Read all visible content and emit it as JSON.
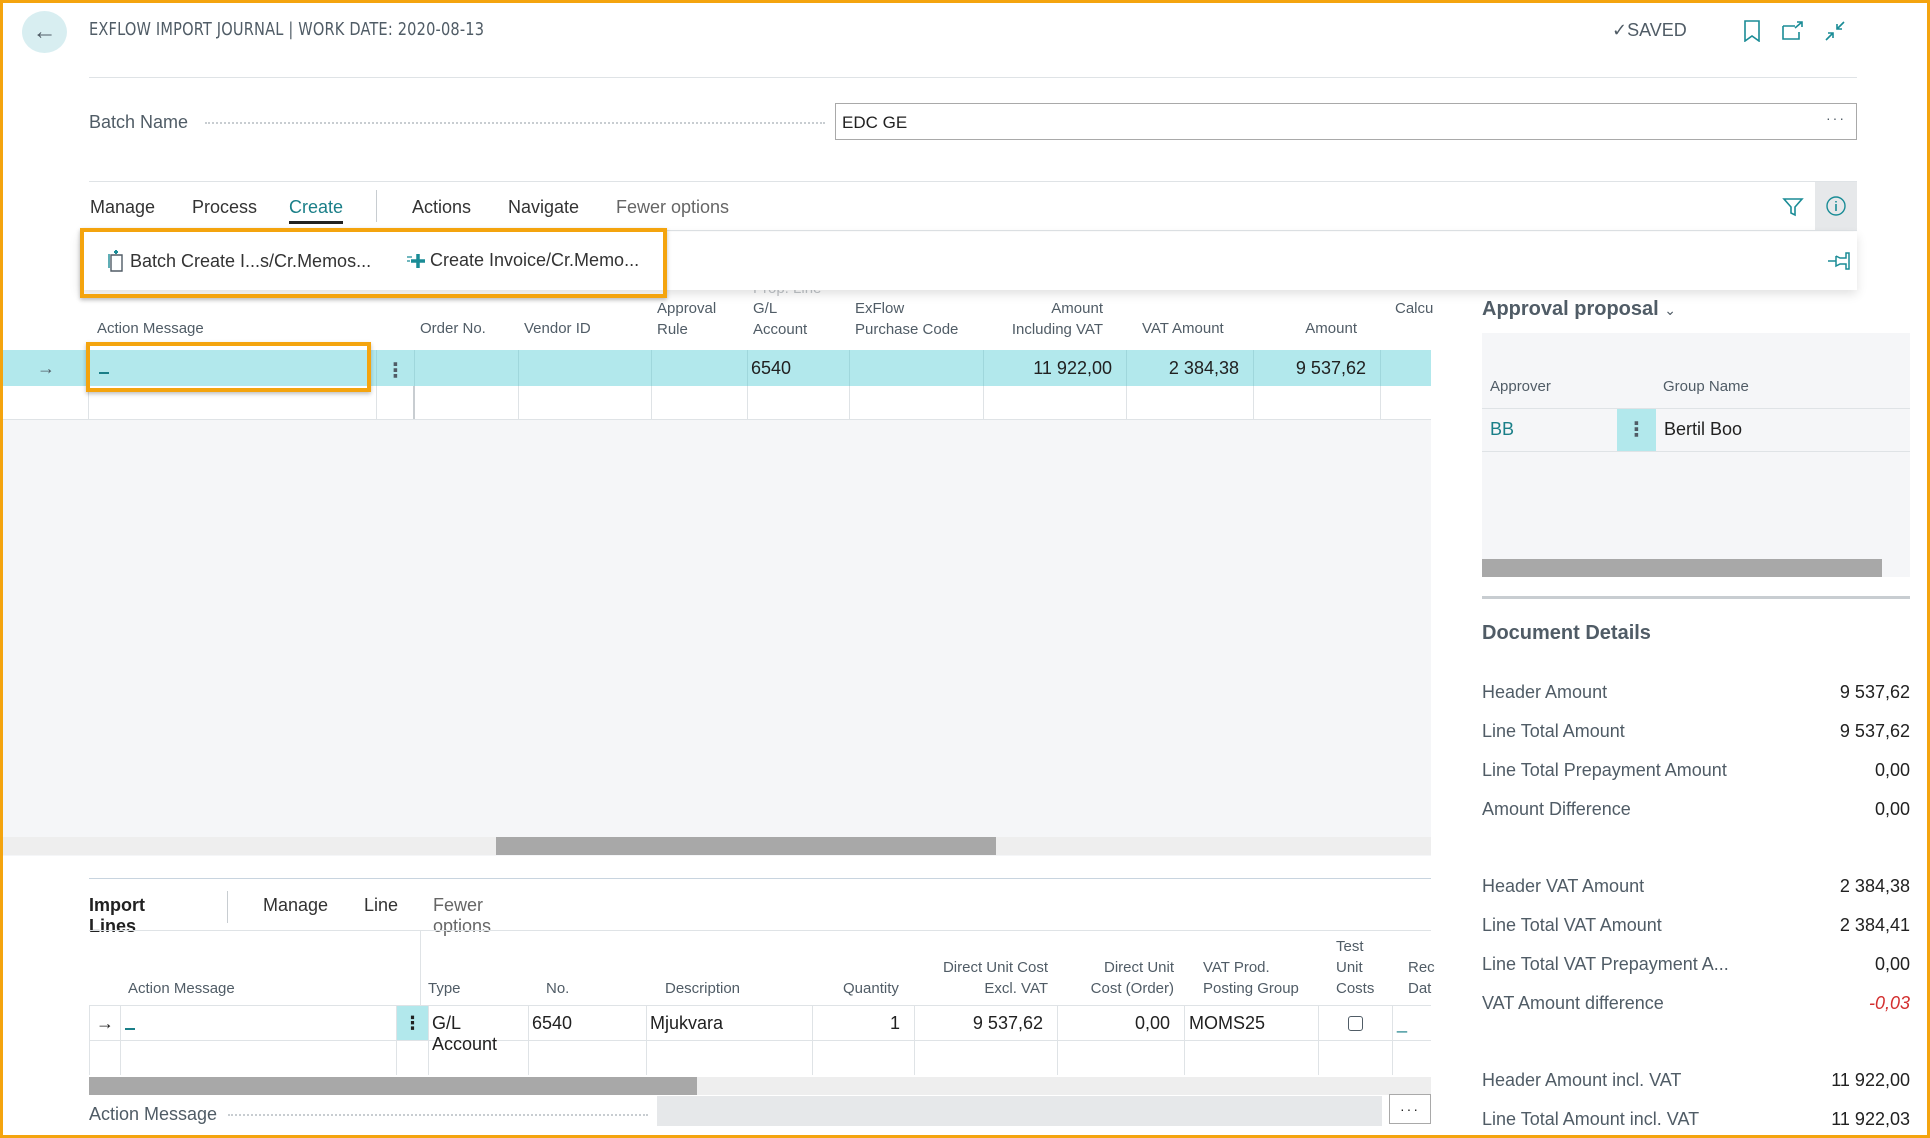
{
  "header": {
    "title": "EXFLOW IMPORT JOURNAL | WORK DATE: 2020-08-13",
    "status": "SAVED",
    "icons": [
      "back-arrow-icon",
      "bookmark-icon",
      "open-new-window-icon",
      "collapse-icon"
    ]
  },
  "batch": {
    "label": "Batch Name",
    "value": "EDC GE",
    "ellipsis": "···"
  },
  "actionbar": {
    "items": [
      {
        "label": "Manage"
      },
      {
        "label": "Process"
      },
      {
        "label": "Create",
        "active": true
      },
      {
        "label": "Actions"
      },
      {
        "label": "Navigate"
      },
      {
        "label": "Fewer options"
      }
    ],
    "create_menu": [
      {
        "label": "Batch Create I...s/Cr.Memos...",
        "icon": "batch-create-icon"
      },
      {
        "label": "Create Invoice/Cr.Memo...",
        "icon": "create-plus-icon"
      }
    ]
  },
  "main_grid": {
    "columns": {
      "action_message": "Action Message",
      "order_no": "Order No.",
      "vendor_id": "Vendor ID",
      "approval_rule_1": "Approval",
      "approval_rule_2": "Rule",
      "gl_0": "Prop. Line",
      "gl_1": "G/L",
      "gl_2": "Account",
      "exflow_1": "ExFlow",
      "exflow_2": "Purchase Code",
      "amt_incl_1": "Amount",
      "amt_incl_2": "Including VAT",
      "vat_amount": "VAT Amount",
      "amount": "Amount",
      "calc": "Calcu"
    },
    "rows": [
      {
        "action_message": "_",
        "order_no": "",
        "vendor_id": "",
        "approval_rule": "",
        "gl_account": "6540",
        "exflow_code": "",
        "amount_incl_vat": "11 922,00",
        "vat_amount": "2 384,38",
        "amount": "9 537,62"
      }
    ]
  },
  "factbox": {
    "approval_title": "Approval proposal",
    "approval_columns": {
      "approver": "Approver",
      "group_name": "Group Name"
    },
    "approval_rows": [
      {
        "approver": "BB",
        "group_name": "Bertil Boo"
      }
    ],
    "details_title": "Document Details",
    "details": [
      {
        "label": "Header Amount",
        "value": "9 537,62"
      },
      {
        "label": "Line Total Amount",
        "value": "9 537,62"
      },
      {
        "label": "Line Total Prepayment Amount",
        "value": "0,00"
      },
      {
        "label": "Amount Difference",
        "value": "0,00"
      },
      {
        "label": "Header VAT Amount",
        "value": "2 384,38"
      },
      {
        "label": "Line Total VAT Amount",
        "value": "2 384,41"
      },
      {
        "label": "Line Total VAT Prepayment A...",
        "value": "0,00"
      },
      {
        "label": "VAT Amount difference",
        "value": "-0,03"
      },
      {
        "label": "Header Amount incl. VAT",
        "value": "11 922,00"
      },
      {
        "label": "Line Total Amount incl. VAT",
        "value": "11 922,03"
      }
    ]
  },
  "import_lines": {
    "title": "Import Lines",
    "actions": [
      "Manage",
      "Line",
      "Fewer options"
    ],
    "columns": {
      "action_message": "Action Message",
      "type": "Type",
      "no": "No.",
      "description": "Description",
      "quantity": "Quantity",
      "duc_excl_1": "Direct Unit Cost",
      "duc_excl_2": "Excl. VAT",
      "duc_order_1": "Direct Unit",
      "duc_order_2": "Cost (Order)",
      "vat_prod_1": "VAT Prod.",
      "vat_prod_2": "Posting Group",
      "test_1": "Test",
      "test_2": "Unit",
      "test_3": "Costs",
      "rec_1": "Rec",
      "rec_2": "Dat"
    },
    "rows": [
      {
        "action_message": "_",
        "type": "G/L Account",
        "no": "6540",
        "description": "Mjukvara",
        "quantity": "1",
        "direct_unit_cost_excl_vat": "9 537,62",
        "direct_unit_cost_order": "0,00",
        "vat_prod_posting_group": "MOMS25",
        "test_unit_costs": false,
        "rec_date": "_"
      }
    ],
    "footer_label": "Action Message",
    "footer_ellipsis": "···"
  },
  "colors": {
    "accent": "#1a8c96",
    "selected_row": "#b2e8ec",
    "highlight_border": "#f4a40e",
    "negative": "#d32f2f"
  }
}
